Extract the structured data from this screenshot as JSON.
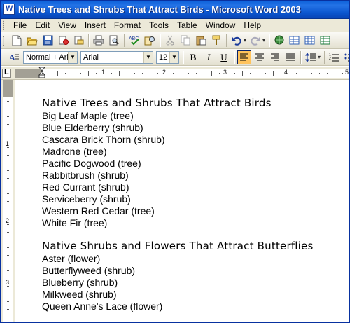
{
  "window": {
    "title": "Native Trees and Shrubs That Attract Birds - Microsoft Word 2003"
  },
  "menubar": {
    "items": [
      {
        "underline": "F",
        "rest": "ile"
      },
      {
        "underline": "E",
        "rest": "dit"
      },
      {
        "underline": "V",
        "rest": "iew"
      },
      {
        "underline": "I",
        "rest": "nsert"
      },
      {
        "pre": "F",
        "underline": "o",
        "rest": "rmat"
      },
      {
        "underline": "T",
        "rest": "ools"
      },
      {
        "pre": "T",
        "underline": "a",
        "rest": "ble"
      },
      {
        "underline": "W",
        "rest": "indow"
      },
      {
        "underline": "H",
        "rest": "elp"
      }
    ]
  },
  "formatting": {
    "style_value": "Normal + Arial",
    "font_value": "Arial",
    "size_value": "12",
    "bold_label": "B",
    "italic_label": "I",
    "underline_label": "U"
  },
  "ruler": {
    "numbers": [
      "1",
      "2",
      "3",
      "4",
      "5"
    ],
    "vnumbers": [
      "1",
      "2",
      "3"
    ]
  },
  "document": {
    "section1": {
      "heading": "Native Trees and Shrubs That Attract Birds",
      "items": [
        "Big Leaf Maple (tree)",
        "Blue Elderberry (shrub)",
        "Cascara Brick Thorn (shrub)",
        "Madrone (tree)",
        "Pacific Dogwood (tree)",
        "Rabbitbrush (shrub)",
        "Red Currant (shrub)",
        "Serviceberry (shrub)",
        "Western Red Cedar (tree)",
        "White Fir (tree)"
      ]
    },
    "section2": {
      "heading": "Native Shrubs and Flowers That Attract Butterflies",
      "items": [
        "Aster (flower)",
        "Butterflyweed (shrub)",
        "Blueberry (shrub)",
        "Milkweed (shrub)",
        "Queen Anne's Lace (flower)"
      ]
    }
  },
  "colors": {
    "titlebar": "#0a5fd8",
    "chrome": "#ece9d8",
    "active_align": "#ffc35c"
  }
}
